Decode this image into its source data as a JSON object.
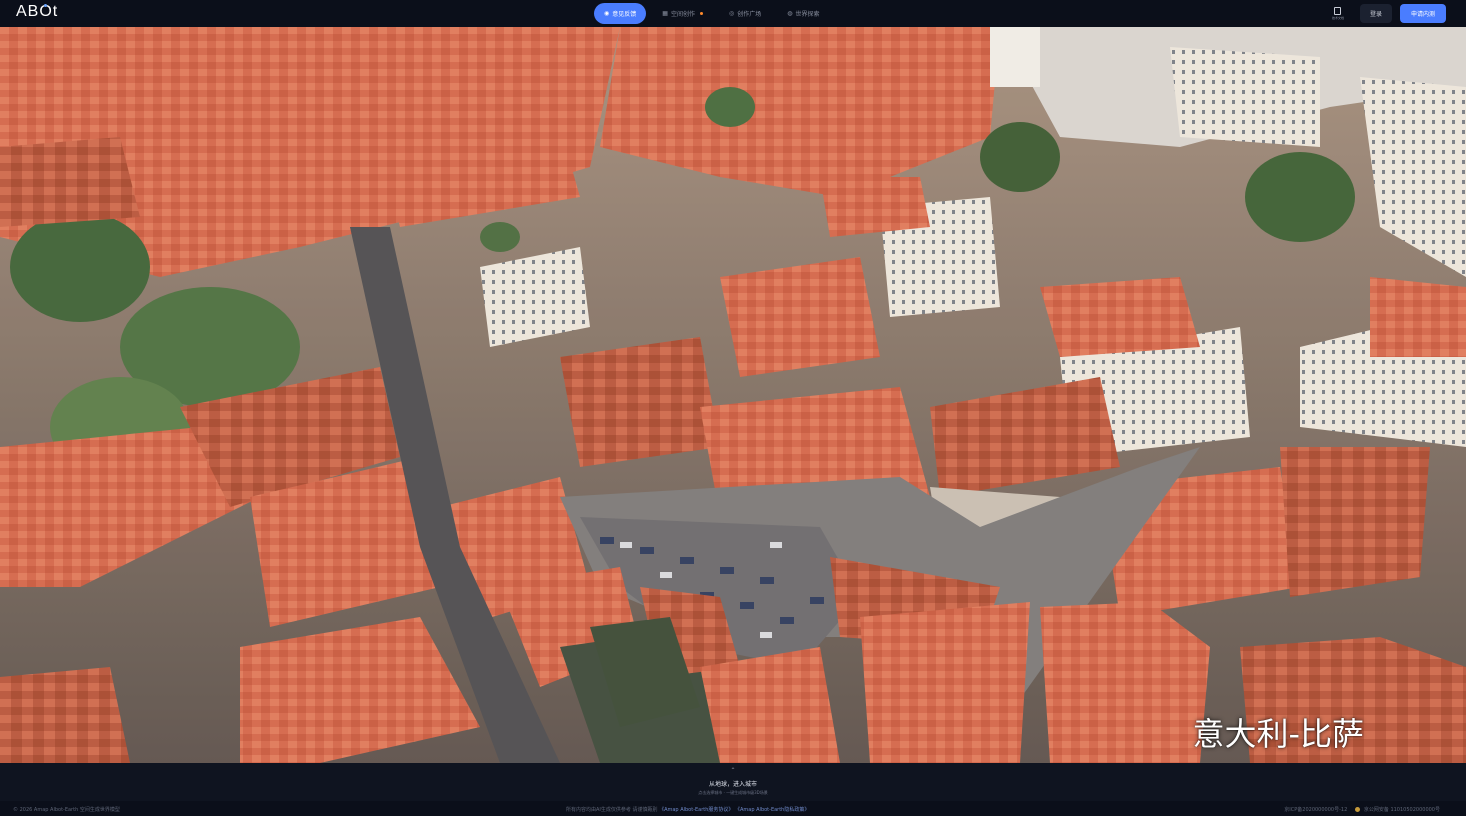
{
  "app": {
    "logo": "ABOt"
  },
  "tabs": [
    {
      "label": "意见反馈",
      "icon": "map-pin-icon",
      "active": true
    },
    {
      "label": "空间创作",
      "icon": "grid-icon",
      "active": false,
      "badge": true
    },
    {
      "label": "创作广场",
      "icon": "compass-icon",
      "active": false
    },
    {
      "label": "世界探索",
      "icon": "globe-icon",
      "active": false
    }
  ],
  "toolbar": {
    "doc_label": "技术文档",
    "login_label": "登录",
    "apply_label": "申请内测"
  },
  "viewport": {
    "caption": "意大利-比萨"
  },
  "bottom_panel": {
    "title": "从地球，进入城市",
    "subtitle": "点击选择城市 · 一键生成城市级3D场景"
  },
  "footer": {
    "left": "© 2026 Amap Albot-Earth 空间生成世界模型",
    "center_text": "所有内容均由AI生成仅供参考 请谨慎甄别 ",
    "center_link1": "《Amap Albot-Earth服务协议》",
    "center_link2": "《Amap Albot-Earth隐私政策》",
    "icp": "京ICP备2020000000号-12",
    "police": "京公网安备 11010502000000号"
  },
  "colors": {
    "accent": "#4a7dff",
    "background": "#0b0f1a",
    "roof": "#d96b4a"
  }
}
